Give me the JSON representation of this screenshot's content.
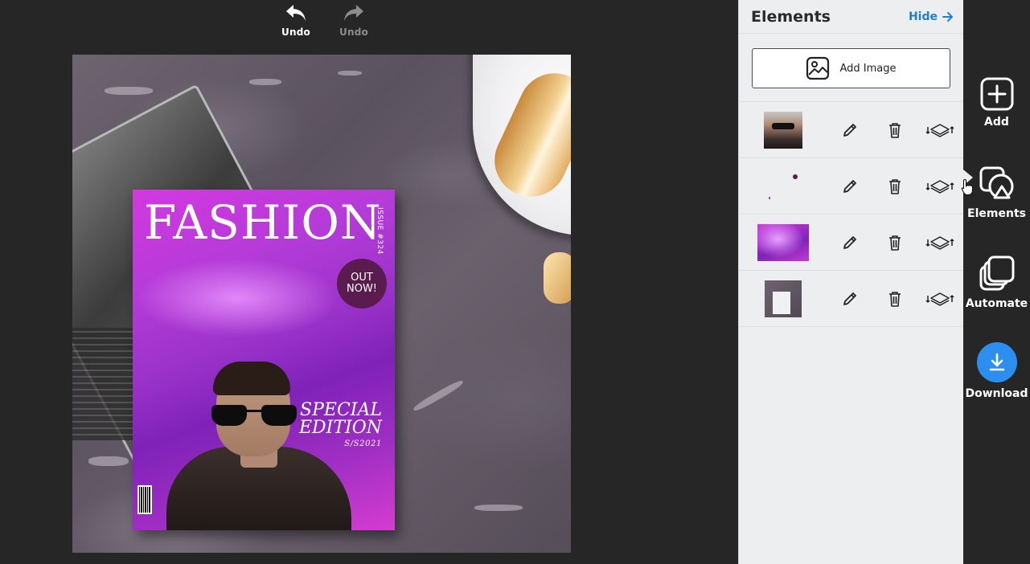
{
  "toolbar": {
    "undo_label": "Undo",
    "redo_label": "Undo"
  },
  "magazine": {
    "title": "FASHION",
    "issue": "ISSUE #324",
    "badge_line1": "OUT",
    "badge_line2": "NOW!",
    "special_line1": "SPECIAL",
    "special_line2": "EDITION",
    "season": "S/S2021"
  },
  "panel": {
    "title": "Elements",
    "hide_label": "Hide",
    "add_image_label": "Add Image",
    "layers": [
      {
        "thumb": "person-photo"
      },
      {
        "thumb": "text-overlay"
      },
      {
        "thumb": "purple-gradient"
      },
      {
        "thumb": "background-photo"
      }
    ]
  },
  "rail": {
    "items": [
      {
        "label": "Add",
        "icon": "plus-square-icon"
      },
      {
        "label": "Elements",
        "icon": "shapes-icon"
      },
      {
        "label": "Automate",
        "icon": "stack-icon"
      },
      {
        "label": "Download",
        "icon": "download-icon"
      }
    ]
  },
  "colors": {
    "accent": "#1e7fd6",
    "download": "#2c8fef",
    "panel_bg": "#edeef0",
    "app_bg": "#262626",
    "magazine_purple": "#b43bd8"
  }
}
